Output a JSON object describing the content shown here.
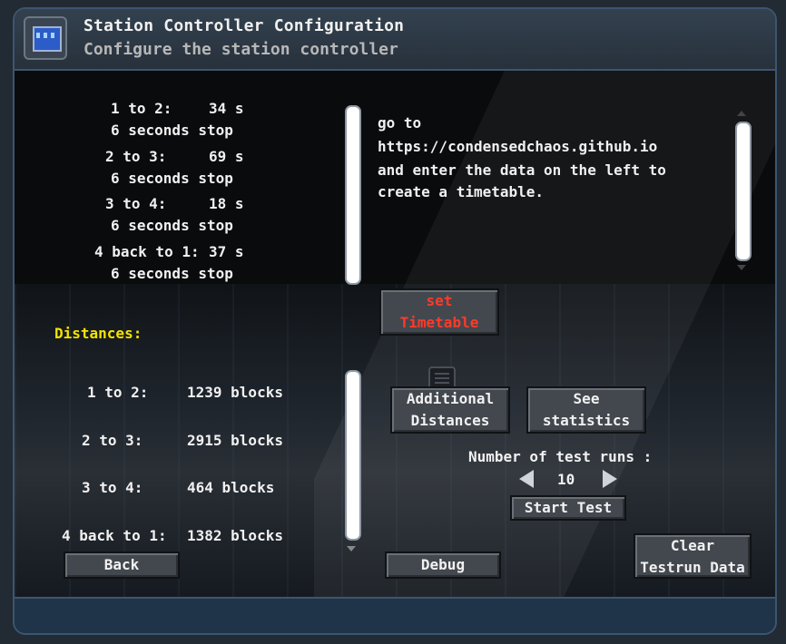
{
  "window": {
    "title": "Station Controller Configuration",
    "subtitle": "Configure the station controller",
    "icon": "monitor-icon"
  },
  "timetable": {
    "lines": [
      {
        "leg": "1 to 2:",
        "time": "34 s",
        "stop": "6 seconds stop"
      },
      {
        "leg": "2 to 3:",
        "time": "69 s",
        "stop": "6 seconds stop"
      },
      {
        "leg": "3 to 4:",
        "time": "18 s",
        "stop": "6 seconds stop"
      },
      {
        "leg": "4 back to 1:",
        "time": "37 s",
        "stop": "6 seconds stop"
      }
    ]
  },
  "info": {
    "lines": [
      "go to",
      "https://condensedchaos.github.io",
      "and enter the data on the left to",
      "create a timetable."
    ]
  },
  "buttons": {
    "set_timetable_line1": "set",
    "set_timetable_line2": "Timetable",
    "additional_line1": "Additional",
    "additional_line2": "Distances",
    "stats_line1": "See",
    "stats_line2": "statistics",
    "start_test": "Start Test",
    "back": "Back",
    "debug": "Debug",
    "clear_line1": "Clear",
    "clear_line2": "Testrun Data"
  },
  "distances": {
    "heading": "Distances:",
    "rows": [
      {
        "leg": "1 to 2:",
        "value": "1239 blocks"
      },
      {
        "leg": "2 to 3:",
        "value": "2915 blocks"
      },
      {
        "leg": "3 to 4:",
        "value": "464 blocks"
      },
      {
        "leg": "4 back to 1:",
        "value": "1382 blocks"
      }
    ]
  },
  "test_runs": {
    "label": "Number of test runs :",
    "value": "10"
  },
  "colors": {
    "accent_yellow": "#f5e300",
    "danger_red": "#ff3a2a",
    "border_blue": "#3d5570"
  }
}
